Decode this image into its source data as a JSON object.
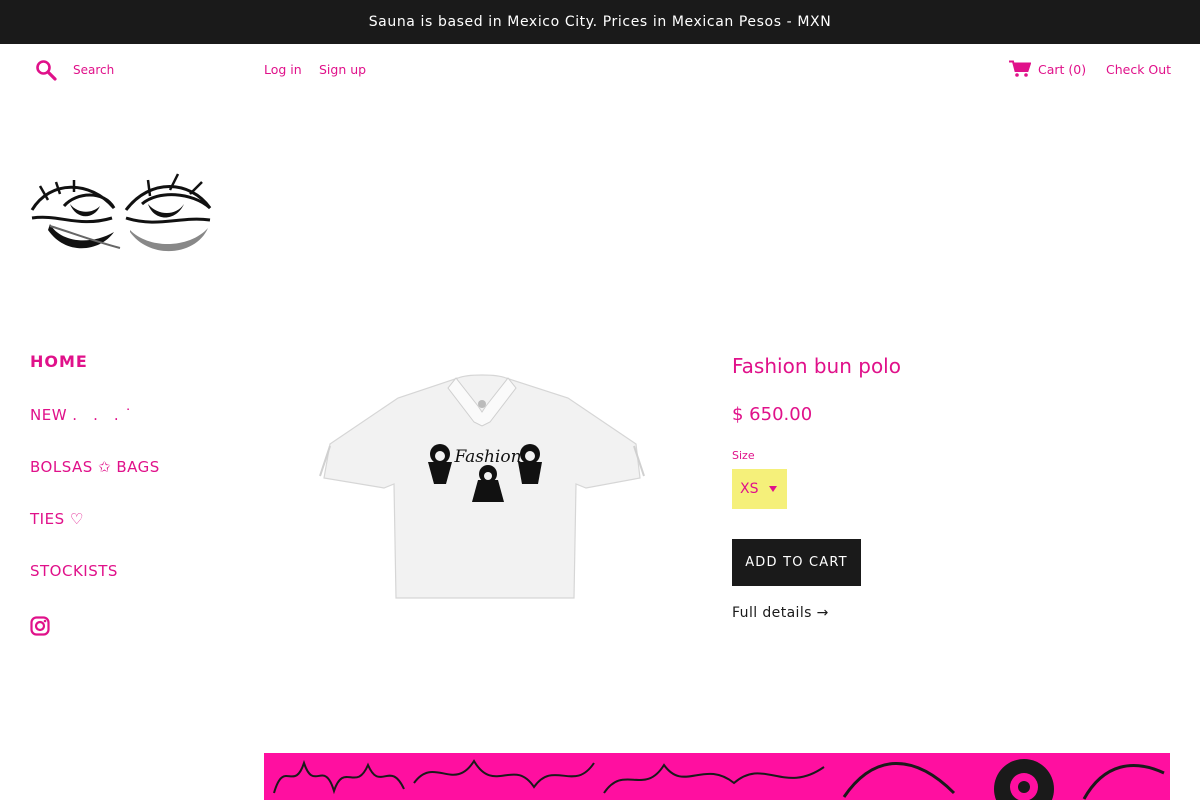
{
  "announcement": "Sauna is based in Mexico City. Prices in Mexican Pesos - MXN",
  "header": {
    "search_placeholder": "Search",
    "login": "Log in",
    "signup": "Sign up",
    "cart": "Cart (0)",
    "checkout": "Check Out"
  },
  "nav": {
    "items": [
      {
        "label": "HOME"
      },
      {
        "label": "NEW . . . ˙"
      },
      {
        "label": "BOLSAS ✩ BAGS"
      },
      {
        "label": "TIES ♡"
      },
      {
        "label": "STOCKISTS"
      }
    ]
  },
  "product": {
    "title": "Fashion bun polo",
    "price": "$ 650.00",
    "size_label": "Size",
    "size_value": "XS",
    "add_to_cart": "ADD TO CART",
    "full_details": "Full details →",
    "print_text": "Fashion"
  },
  "colors": {
    "accent": "#e0118a",
    "dark": "#1a1a1a",
    "select_bg": "#f5f07a",
    "banner": "#ff0fa0"
  },
  "icons": [
    "search-icon",
    "cart-icon",
    "instagram-icon"
  ]
}
